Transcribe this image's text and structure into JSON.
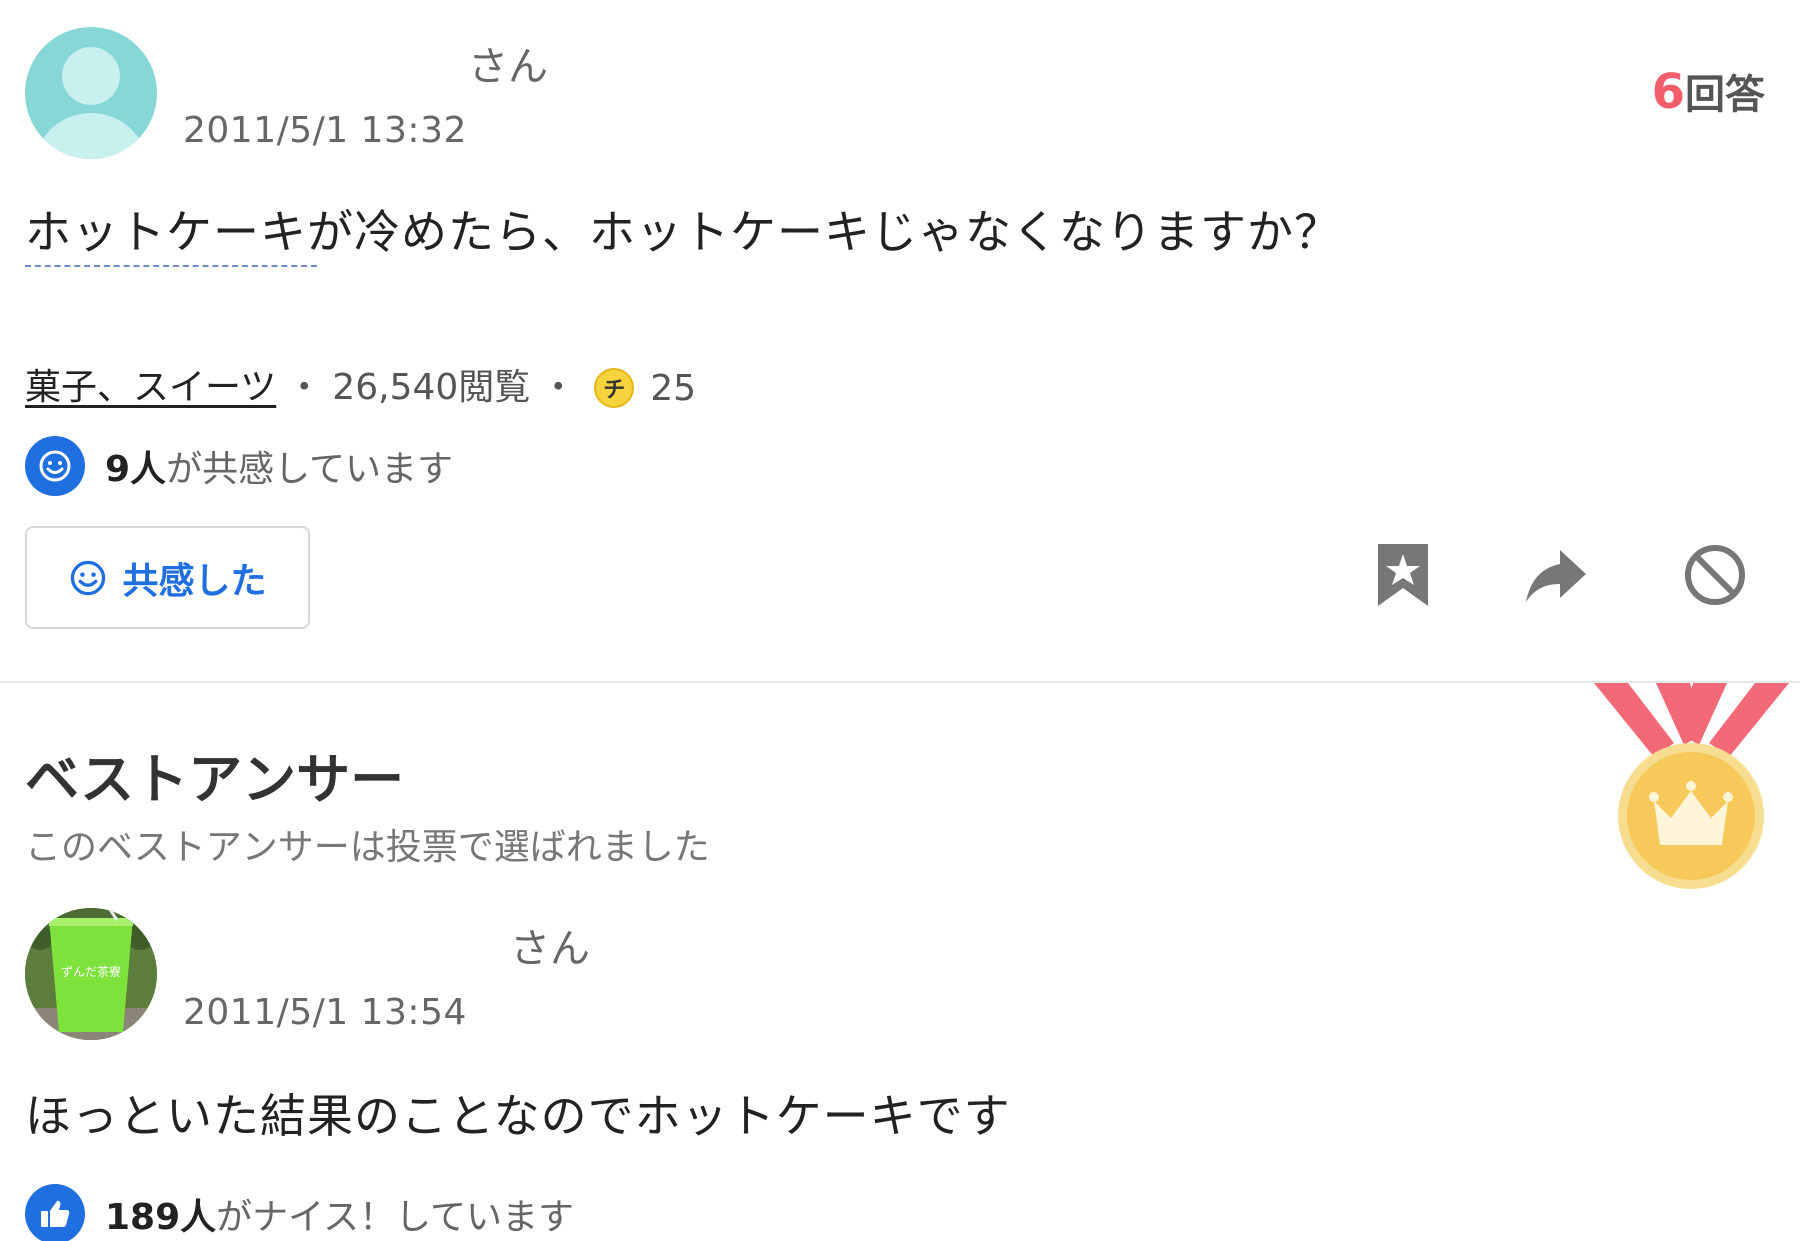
{
  "question": {
    "user_suffix": "さん",
    "date": "2011/5/1 13:32",
    "answers_count": "6",
    "answers_label": "回答",
    "text": "ホットケーキが冷めたら、ホットケーキじゃなくなりますか？",
    "category": "菓子、スイーツ",
    "views": "26,540閲覧",
    "coin_symbol": "チ",
    "coins": "25",
    "empathy_count": "9人",
    "empathy_suffix": "が共感しています",
    "empathy_button_label": "共感した"
  },
  "best_answer": {
    "title": "ベストアンサー",
    "subtitle": "このベストアンサーは投票で選ばれました",
    "avatar_cup_text": "ずんだ茶寮",
    "user_suffix": "さん",
    "date": "2011/5/1 13:54",
    "text": "ほっといた結果のことなのでホットケーキです",
    "nice_count": "189人",
    "nice_suffix": "がナイス！しています"
  },
  "icons": {
    "bookmark": "bookmark-star-icon",
    "share": "share-arrow-icon",
    "block": "block-icon",
    "medal": "medal-crown-icon"
  },
  "colors": {
    "accent_blue": "#1f6fe0",
    "answers_red": "#f25d6b",
    "medal_gold": "#f7c95a",
    "ribbon_red": "#f26a78",
    "avatar_teal": "#86d7d6"
  }
}
